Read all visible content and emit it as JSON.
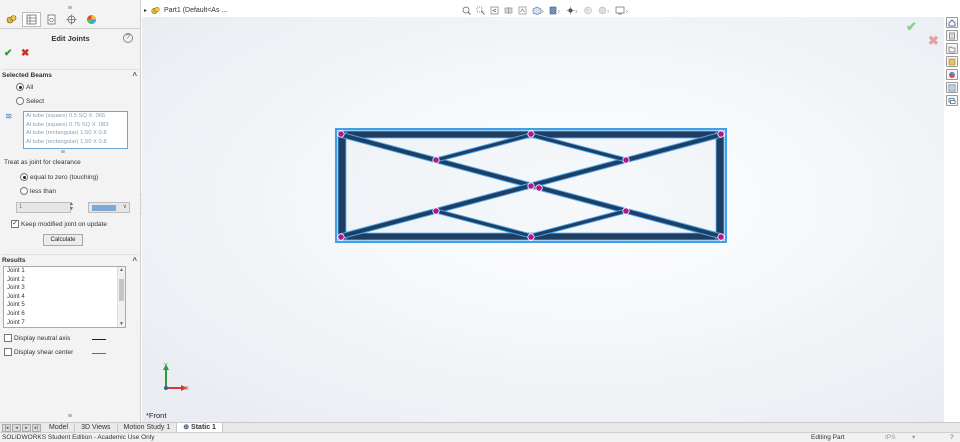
{
  "panel": {
    "title": "Edit Joints",
    "help": "?",
    "ok": "✔",
    "cancel": "✖",
    "selected_beams": {
      "header": "Selected Beams",
      "option_all": "All",
      "option_select": "Select",
      "selected_option": "All",
      "beams": [
        "Al tube (square) 0.5 SQ X .065",
        "Al tube (square) 0.75 SQ X .083",
        "Al tube (rectangular) 1.50 X 0.8",
        "Al tube (rectangular) 1.50 X 0.8"
      ]
    },
    "clearance": {
      "label": "Treat as joint for clearance",
      "option_equal": "equal to zero (touching)",
      "option_less": "less than",
      "selected_option": "equal to zero (touching)",
      "value": "1"
    },
    "keep_modified": {
      "label": "Keep modified joint on update",
      "checked": true
    },
    "calculate_label": "Calculate",
    "results": {
      "header": "Results",
      "items": [
        "Joint 1",
        "Joint 2",
        "Joint 3",
        "Joint 4",
        "Joint 5",
        "Joint 6",
        "Joint 7"
      ]
    },
    "display_neutral_axis": {
      "label": "Display neutral axis",
      "checked": false,
      "color": "#222222"
    },
    "display_shear_center": {
      "label": "Display shear center",
      "checked": false,
      "color": "#d23a3a"
    }
  },
  "document": {
    "tree_label": "Part1  (Default<As ..."
  },
  "view": {
    "name": "*Front",
    "axis_x": "X",
    "axis_y": "Y"
  },
  "tabs": [
    {
      "label": "Model",
      "active": false
    },
    {
      "label": "3D Views",
      "active": false
    },
    {
      "label": "Motion Study 1",
      "active": false
    },
    {
      "label": "Static 1",
      "active": true
    }
  ],
  "status": {
    "left": "SOLIDWORKS Student Edition - Academic Use Only",
    "mode": "Editing Part",
    "units": "IPS",
    "menu": "▾"
  },
  "colors": {
    "beam_dark": "#1f3e63",
    "beam_highlight": "#3f9fe8",
    "joint": "#b0178f",
    "accent": "#1b6fd1"
  }
}
